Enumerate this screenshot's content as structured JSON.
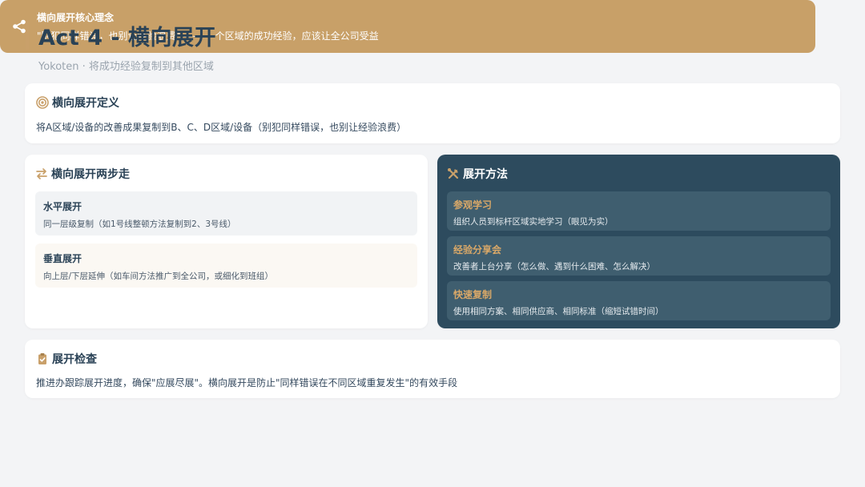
{
  "header": {
    "title": "Act 4 - 横向展开",
    "subtitle": "Yokoten · 将成功经验复制到其他区域"
  },
  "definition": {
    "icon": "target-icon",
    "heading": "横向展开定义",
    "text": "将A区域/设备的改善成果复制到B、C、D区域/设备（别犯同样错误，也别让经验浪费）"
  },
  "steps": {
    "icon": "arrows-exchange-icon",
    "heading": "横向展开两步走",
    "items": [
      {
        "title": "水平展开",
        "desc": "同一层级复制（如1号线整顿方法复制到2、3号线）"
      },
      {
        "title": "垂直展开",
        "desc": "向上层/下层延伸（如车间方法推广到全公司，或细化到班组）"
      }
    ]
  },
  "methods": {
    "icon": "tools-icon",
    "heading": "展开方法",
    "items": [
      {
        "title": "参观学习",
        "desc": "组织人员到标杆区域实地学习（眼见为实）"
      },
      {
        "title": "经验分享会",
        "desc": "改善者上台分享（怎么做、遇到什么困难、怎么解决）"
      },
      {
        "title": "快速复制",
        "desc": "使用相同方案、相同供应商、相同标准（缩短试错时间）"
      }
    ]
  },
  "check": {
    "icon": "clipboard-check-icon",
    "heading": "展开检查",
    "text": "推进办跟踪展开进度，确保\"应展尽展\"。横向展开是防止\"同样错误在不同区域重复发生\"的有效手段"
  },
  "core": {
    "icon": "share-icon",
    "title": "横向展开核心理念",
    "quote": "\"别犯同样错误，也别让经验浪费\" —— 一个区域的成功经验，应该让全公司受益"
  },
  "colors": {
    "accent": "#c9a06a",
    "dark_panel": "#2d4b5e",
    "core_banner": "#c8a068"
  }
}
